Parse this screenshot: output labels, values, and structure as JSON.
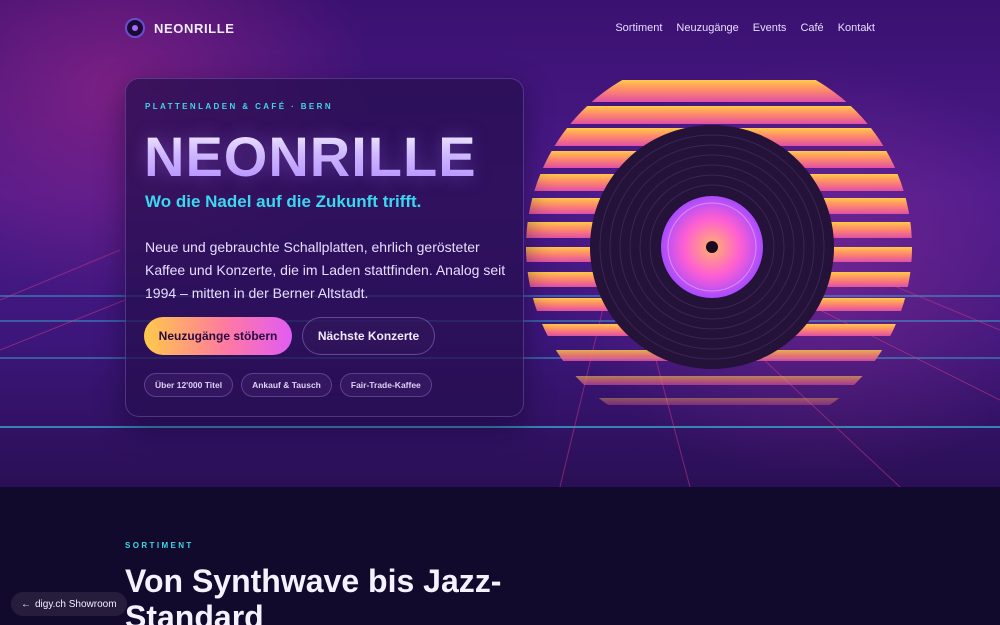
{
  "nav": {
    "brand": "NEONRILLE",
    "links": [
      "Sortiment",
      "Neuzugänge",
      "Events",
      "Café",
      "Kontakt"
    ]
  },
  "hero": {
    "eyebrow": "PLATTENLADEN & CAFÉ · BERN",
    "title": "NEONRILLE",
    "tagline": "Wo die Nadel auf die Zukunft trifft.",
    "description": "Neue und gebrauchte Schallplatten, ehrlich gerösteter Kaffee und Konzerte, die im Laden stattfinden. Analog seit 1994 – mitten in der Berner Altstadt.",
    "primary_button": "Neuzugänge stöbern",
    "secondary_button": "Nächste Konzerte",
    "chips": [
      "Über 12'000 Titel",
      "Ankauf & Tausch",
      "Fair-Trade-Kaffee"
    ]
  },
  "section": {
    "eyebrow": "SORTIMENT",
    "title": "Von Synthwave bis Jazz-Standard"
  },
  "badge": {
    "icon": "arrow-left-icon",
    "label": "digy.ch Showroom"
  },
  "colors": {
    "accent_cyan": "#3ad8ef",
    "sun_top": "#ffc94a",
    "sun_bottom": "#e04fa6",
    "record_label": "#ff5fd2"
  }
}
